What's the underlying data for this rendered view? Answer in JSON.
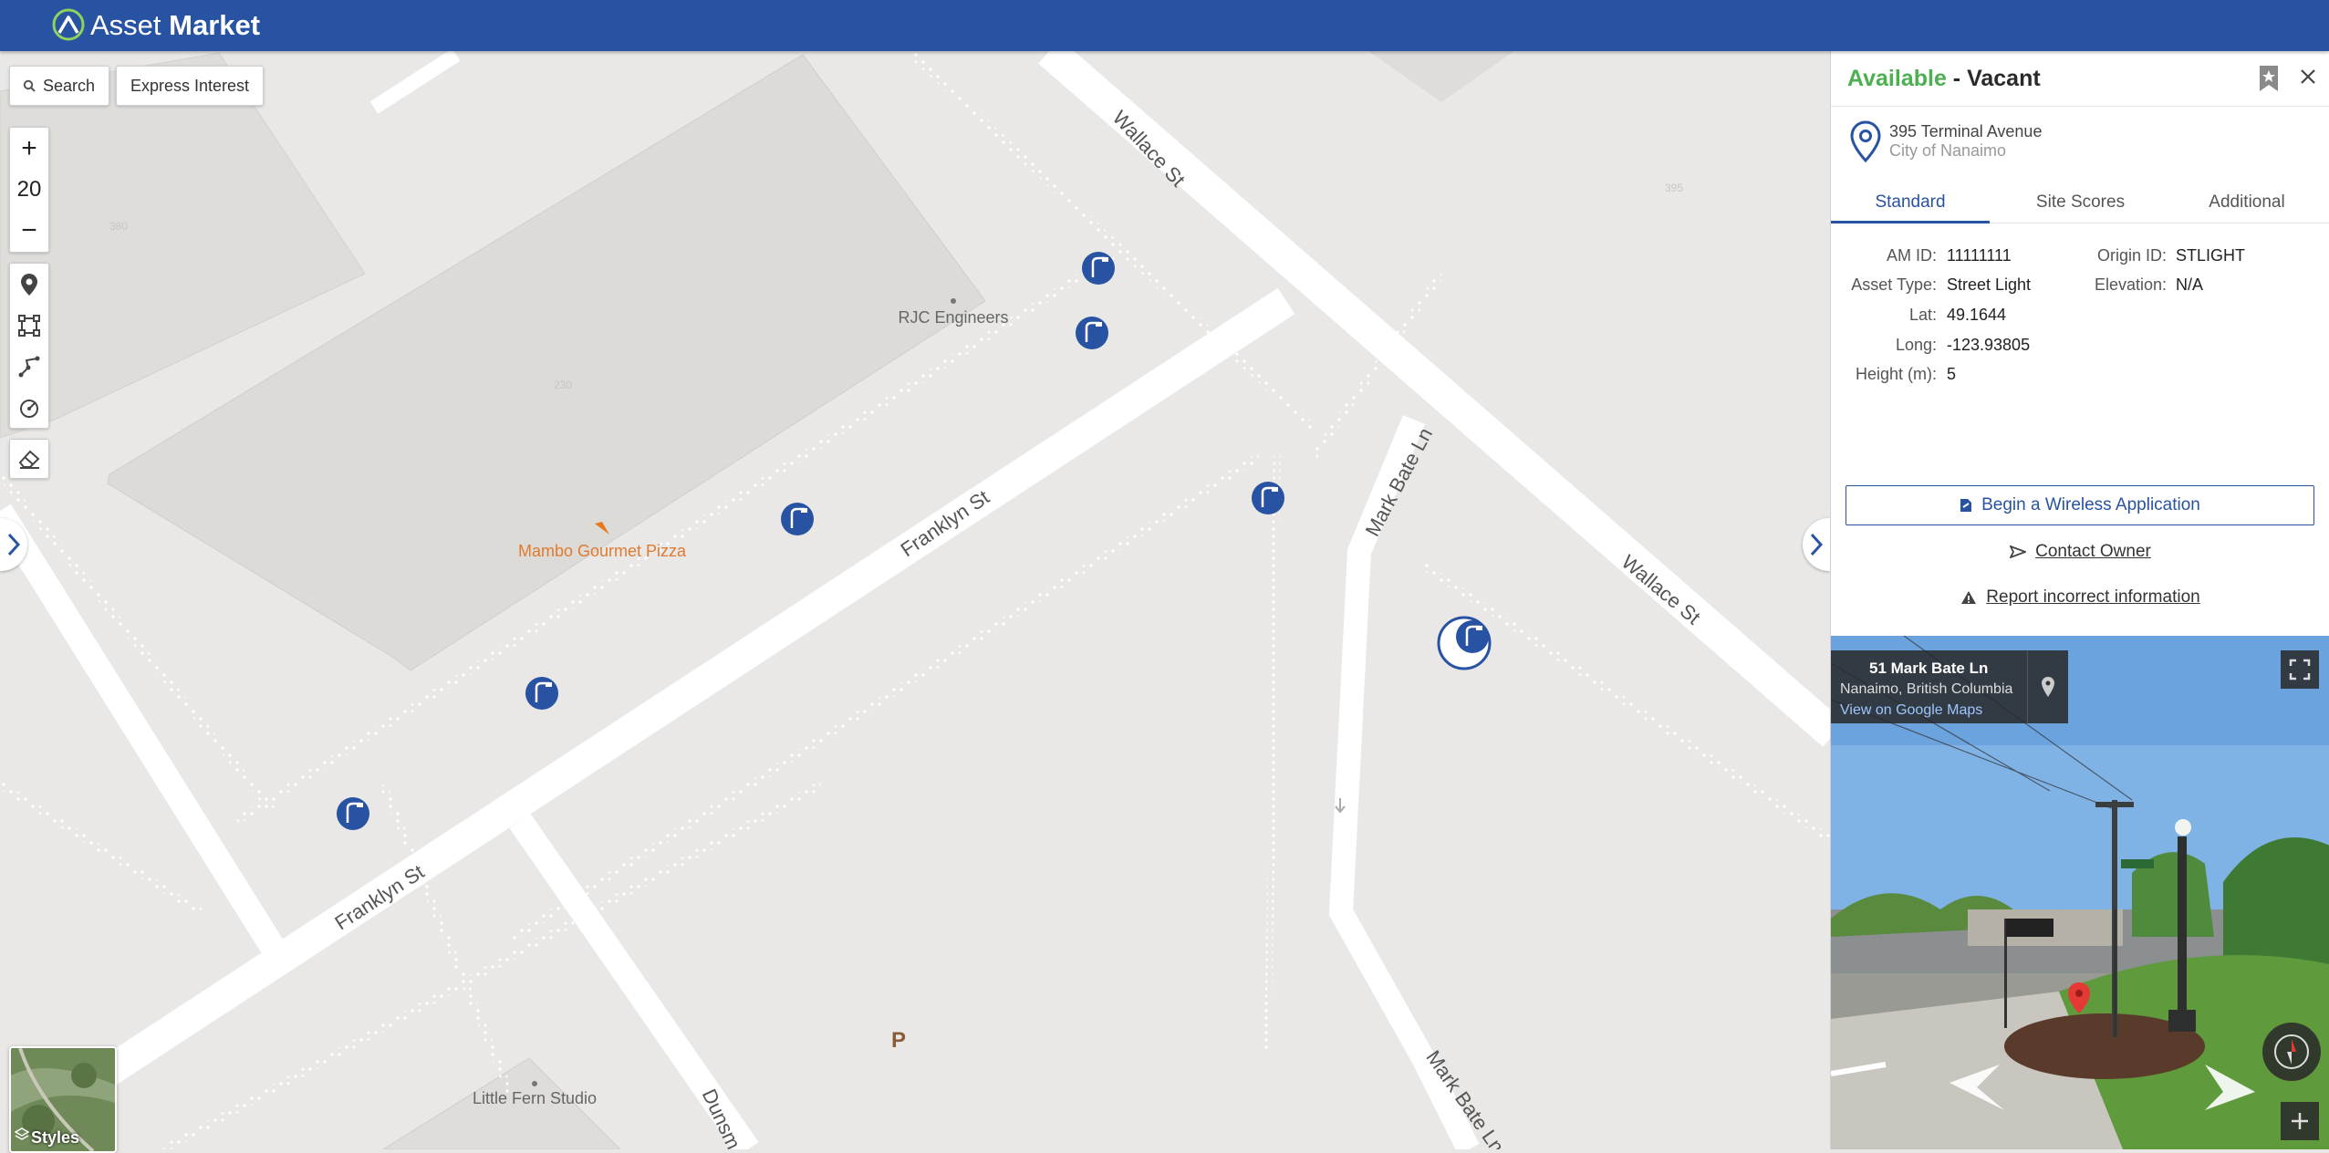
{
  "app": {
    "brand_light": "Asset ",
    "brand_bold": "Market"
  },
  "toolbar": {
    "search_label": "Search",
    "express_label": "Express Interest",
    "zoom_level": "20",
    "zoom_in": "+",
    "zoom_out": "−"
  },
  "map": {
    "street_labels": [
      "Wallace St",
      "Wallace St",
      "Franklyn St",
      "Franklyn St",
      "Mark Bate Ln",
      "Mark Bate Ln",
      "Dunsm"
    ],
    "places": [
      "RJC Engineers",
      "Mambo Gourmet Pizza",
      "Little Fern Studio"
    ],
    "parking": "P",
    "styles_label": "Styles"
  },
  "panel": {
    "status": "Available",
    "status_sep": " - ",
    "status_detail": "Vacant",
    "address_line1": "395 Terminal Avenue",
    "address_line2": "City of Nanaimo",
    "tabs": [
      "Standard",
      "Site Scores",
      "Additional"
    ],
    "fields_left": [
      {
        "label": "AM ID:",
        "value": "11111111"
      },
      {
        "label": "Asset Type:",
        "value": "Street Light"
      },
      {
        "label": "Lat:",
        "value": "49.1644"
      },
      {
        "label": "Long:",
        "value": "-123.93805"
      },
      {
        "label": "Height (m):",
        "value": "5"
      }
    ],
    "fields_right": [
      {
        "label": "Origin ID:",
        "value": "STLIGHT"
      },
      {
        "label": "Elevation:",
        "value": "N/A"
      }
    ],
    "apply_label": "Begin a Wireless Application",
    "contact_label": "Contact Owner",
    "report_label": "Report incorrect information"
  },
  "streetview": {
    "title": "51 Mark Bate Ln",
    "subtitle": "Nanaimo, British Columbia",
    "link": "View on Google Maps"
  },
  "colors": {
    "brand": "#2853a3",
    "available": "#4caf50",
    "marker": "#2853a3"
  }
}
